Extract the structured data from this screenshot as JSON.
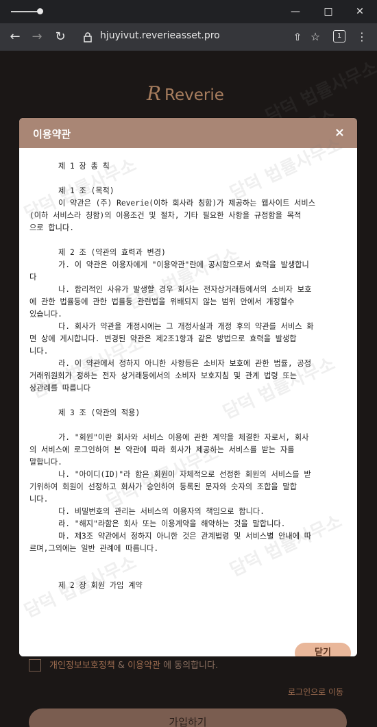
{
  "browser": {
    "url": "hjuyivut.reverieasset.pro",
    "tab_count": "1"
  },
  "page": {
    "logo_text": "Reverie",
    "agree_label_part1": "개인정보보호정책",
    "agree_label_sep": " & ",
    "agree_label_part2": "이용약관",
    "agree_label_part3": " 에 동의합니다.",
    "login_link": "로그인으로 이동",
    "join_button": "가입하기"
  },
  "modal": {
    "title": "이용약관",
    "close_icon": "×",
    "close_button": "닫기",
    "lines": [
      "제 1 장 총 칙",
      "",
      "제 1 조 (목적)",
      "이 약관은 (주) Reverie(이하 회사라 칭함)가 제공하는 웹사이트 서비스",
      "(이하 서비스라 칭함)의 이용조건 및 절차, 기타 필요한 사항을 규정함을 목적",
      "으로 합니다.",
      "",
      "제 2 조 (약관의 효력과 변경)",
      "가. 이 약관은 이용자에게 \"이용약관\"란에 공시함으로서 효력을 발생합니",
      "다",
      "나. 합리적인 사유가 발생할 경우 회사는 전자상거래등에서의 소비자 보호",
      "에 관한 법률등에 관한 법률등 관련법을 위배되지 않는 범위 안에서 개정할수",
      "있습니다.",
      "다. 회사가 약관을 개정시에는 그 개정사실과 개정 후의 약관를 서비스 화",
      "면 상에 게시합니다. 변경된 약관은 제2조1항과 같은 방법으로 효력을 발생합",
      "니다.",
      "라. 이 약관에서 정하지 아니한 사항등은 소비자 보호에 관한 법률, 공정",
      "거래위원회가 정하는 전자 상거래등에서의 소비자 보호지침 및 관계 법령 또는",
      "상관례를 따릅니다",
      "",
      "제 3 조 (약관의 적용)",
      "",
      "가. \"회원\"이란 회사와 서비스 이용에 관한 계약을 체결한 자로서, 회사",
      "의 서비스에 로그인하여 본 약관에 따라 회사가 제공하는 서비스를 받는 자를",
      "말합니다.",
      "나. \"아이디(ID)\"라 함은 회원이 자체적으로 선정한 회원의 서비스를 받",
      "기위하여 회원이 선정하고 회사가 승인하여 등록된 문자와 숫자의 조합을 말합",
      "니다.",
      "다. 비밀번호의 관리는 서비스의 이용자의 책임으로 합니다.",
      "라. \"해지\"라함은 회사 또는 이용계약을 해약하는 것을 말합니다.",
      "마. 제3조 약관에서 정하지 아니한 것은 관계법령 및 서비스별 안내에 따",
      "르며,그외에는 일반 관례에 따릅니다.",
      "",
      "",
      "제 2 장 회원 가입 계약"
    ]
  },
  "watermark": "담덕 법률사무소",
  "colors": {
    "modal_header": "#a98675",
    "close_button_bg": "#e9b79a",
    "page_bg": "#1b1716",
    "brand": "#a77d5e"
  },
  "icons": [
    "slider-icon",
    "minimize-icon",
    "maximize-icon",
    "close-window-icon",
    "back-icon",
    "forward-icon",
    "reload-icon",
    "lock-icon",
    "share-icon",
    "bookmark-icon",
    "tabs-icon",
    "menu-icon",
    "checkbox-icon"
  ]
}
